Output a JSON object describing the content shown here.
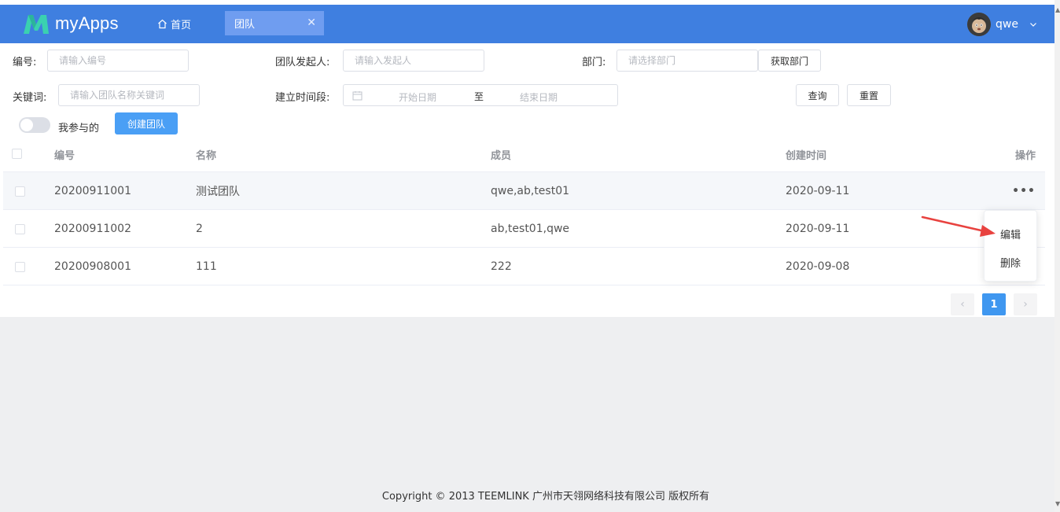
{
  "header": {
    "logo_text": "myApps",
    "home_label": "首页",
    "active_tab": "团队",
    "username": "qwe"
  },
  "filters": {
    "number_label": "编号:",
    "number_placeholder": "请输入编号",
    "initiator_label": "团队发起人:",
    "initiator_placeholder": "请输入发起人",
    "dept_label": "部门:",
    "dept_placeholder": "请选择部门",
    "get_dept_button": "获取部门",
    "keyword_label": "关键词:",
    "keyword_placeholder": "请输入团队名称关键词",
    "period_label": "建立时间段:",
    "start_placeholder": "开始日期",
    "range_separator": "至",
    "end_placeholder": "结束日期",
    "query_button": "查询",
    "reset_button": "重置",
    "mine_toggle_label": "我参与的",
    "create_button": "创建团队"
  },
  "table": {
    "columns": [
      "编号",
      "名称",
      "成员",
      "创建时间",
      "操作"
    ],
    "rows": [
      {
        "id": "20200911001",
        "name": "测试团队",
        "members": "qwe,ab,test01",
        "created": "2020-09-11"
      },
      {
        "id": "20200911002",
        "name": "2",
        "members": "ab,test01,qwe",
        "created": "2020-09-11"
      },
      {
        "id": "20200908001",
        "name": "111",
        "members": "222",
        "created": "2020-09-08"
      }
    ],
    "more_symbol": "•••"
  },
  "dropdown": {
    "edit": "编辑",
    "delete": "删除"
  },
  "pagination": {
    "current_page": "1",
    "prev_symbol": "‹",
    "next_symbol": "›"
  },
  "footer": {
    "copyright": "Copyright © 2013 TEEMLINK 广州市天翎网络科技有限公司 版权所有"
  },
  "colors": {
    "header_bg": "#3f7fe0",
    "primary": "#4a9ff5",
    "annotation_arrow": "#e8423f"
  }
}
